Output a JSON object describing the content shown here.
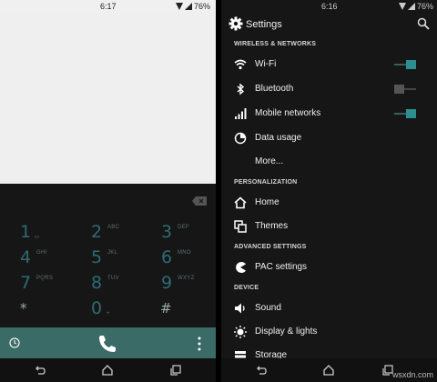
{
  "left": {
    "status": {
      "time": "6:17",
      "battery": "76%"
    },
    "dialpad": {
      "keys": [
        {
          "digit": "1",
          "letters": "ₒₒ"
        },
        {
          "digit": "2",
          "letters": "ABC"
        },
        {
          "digit": "3",
          "letters": "DEF"
        },
        {
          "digit": "4",
          "letters": "GHI"
        },
        {
          "digit": "5",
          "letters": "JKL"
        },
        {
          "digit": "6",
          "letters": "MNO"
        },
        {
          "digit": "7",
          "letters": "PQRS"
        },
        {
          "digit": "8",
          "letters": "TUV"
        },
        {
          "digit": "9",
          "letters": "WXYZ"
        },
        {
          "digit": "*",
          "letters": ""
        },
        {
          "digit": "0",
          "letters": "+"
        },
        {
          "digit": "#",
          "letters": ""
        }
      ]
    }
  },
  "right": {
    "status": {
      "time": "6:16",
      "battery": "76%"
    },
    "title": "Settings",
    "sections": {
      "wireless": "WIRELESS & NETWORKS",
      "personalization": "PERSONALIZATION",
      "advanced": "ADVANCED SETTINGS",
      "device": "DEVICE"
    },
    "items": {
      "wifi": "Wi-Fi",
      "bluetooth": "Bluetooth",
      "mobile": "Mobile networks",
      "data": "Data usage",
      "more": "More...",
      "home": "Home",
      "themes": "Themes",
      "pac": "PAC settings",
      "sound": "Sound",
      "display": "Display & lights",
      "storage": "Storage"
    },
    "toggles": {
      "wifi": true,
      "bluetooth": false,
      "mobile": true
    }
  },
  "colors": {
    "accent": "#2b8e8f",
    "callbar": "#3a6b66",
    "digit": "#2e6a73"
  },
  "watermark": "wsxdn.com"
}
